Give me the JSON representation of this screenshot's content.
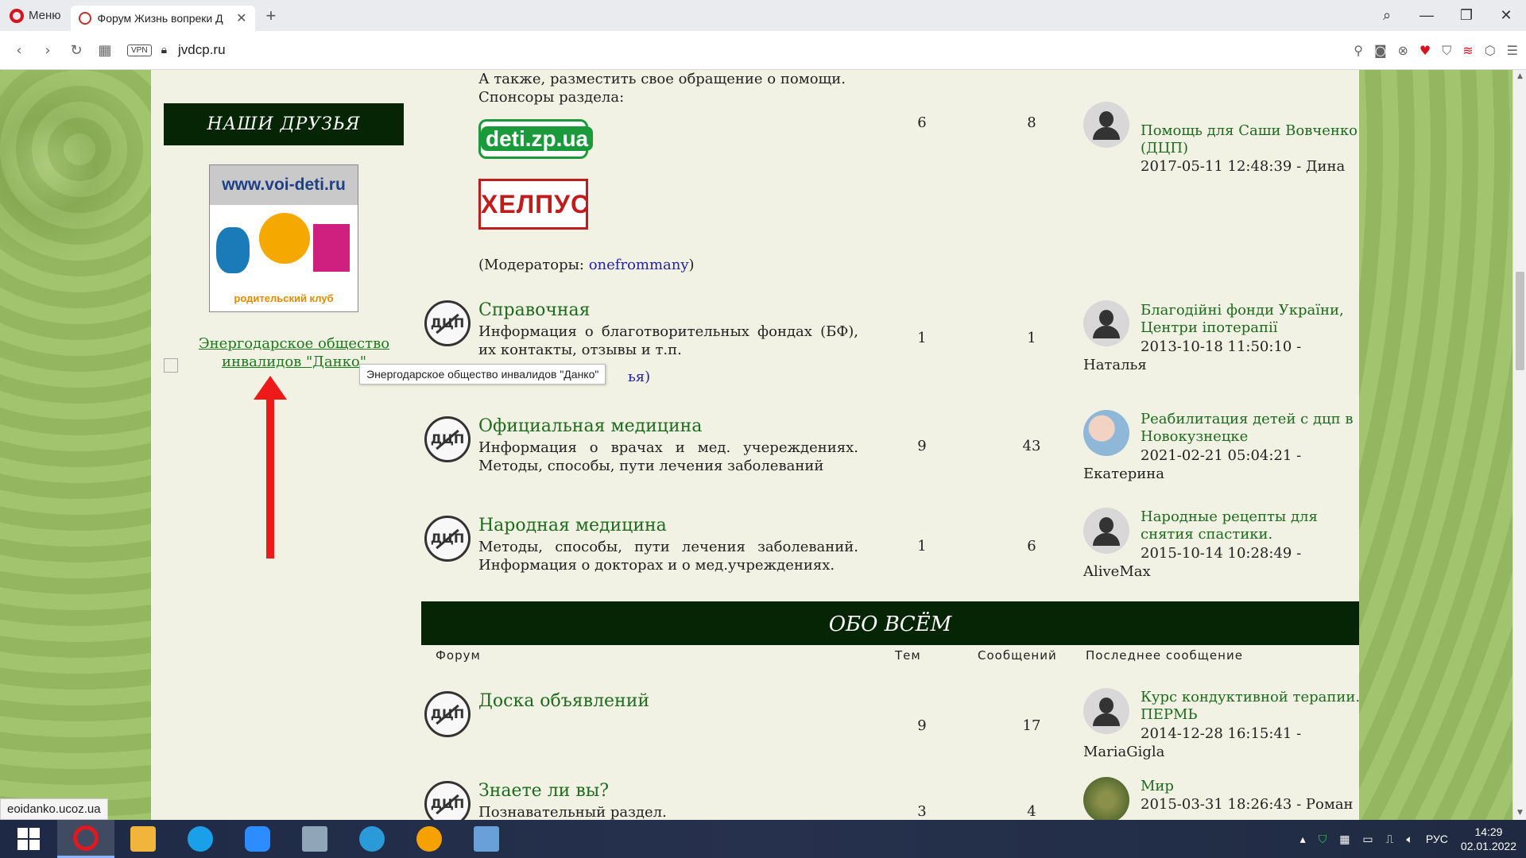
{
  "browser": {
    "menu_label": "Меню",
    "tab_title": "Форум Жизнь вопреки Д",
    "url": "jvdcp.ru",
    "vpn_label": "VPN"
  },
  "statusbar": {
    "text": "eoidanko.ucoz.ua"
  },
  "sidebar": {
    "friends_heading": "НАШИ ДРУЗЬЯ",
    "voi_site": "www.voi-deti.ru",
    "voi_sub": "родительский клуб",
    "danko_link": "Энергодарское общество инвалидов \"Данко\"",
    "tooltip": "Энергодарское общество инвалидов \"Данко\""
  },
  "top_block": {
    "desc_line1": "А также, разместить свое обращение о помощи.",
    "desc_line2": "Спонсоры раздела:",
    "sponsor1": "deti.zp.ua",
    "sponsor2": "ХЕЛПУС",
    "moderators_prefix": "(Модераторы: ",
    "moderator": "onefrommany",
    "moderators_suffix": ")",
    "topics": "6",
    "posts": "8",
    "last_title": "Помощь для Саши Вовченко (ДЦП)",
    "last_meta": "2017-05-11 12:48:39 - Дина"
  },
  "forums": [
    {
      "title": "Справочная",
      "desc": "Информация о благотворительных фондах (БФ), их контакты, отзывы и т.п.",
      "mod_partial": "ья)",
      "topics": "1",
      "posts": "1",
      "last_title": "Благодійні фонди України, Центри іпотерапії",
      "last_meta": "2013-10-18 11:50:10 - Наталья"
    },
    {
      "title": "Официальная медицина",
      "desc": "Информация о врачах и мед. учереждениях. Методы, способы, пути лечения заболеваний",
      "topics": "9",
      "posts": "43",
      "last_title": "Реабилитация детей с дцп в Новокузнецке",
      "last_meta": "2021-02-21 05:04:21 - Екатерина"
    },
    {
      "title": "Народная медицина",
      "desc": "Методы, способы, пути лечения заболеваний. Информация о докторах и о мед.учреждениях.",
      "topics": "1",
      "posts": "6",
      "last_title": "Народные рецепты для снятия спастики.",
      "last_meta": "2015-10-14 10:28:49 - AliveMax"
    }
  ],
  "section2": {
    "heading": "ОБО ВСЁМ",
    "col_forum": "Форум",
    "col_topics": "Тем",
    "col_posts": "Сообщений",
    "col_last": "Последнее сообщение"
  },
  "forums2": [
    {
      "title": "Доска объявлений",
      "topics": "9",
      "posts": "17",
      "last_title": "Курс кондуктивной терапии. ПЕРМЬ",
      "last_meta": "2014-12-28 16:15:41 - MariaGigla"
    },
    {
      "title": "Знаете ли вы?",
      "desc": "Познавательный раздел.",
      "topics": "3",
      "posts": "4",
      "last_title": "Мир",
      "last_meta": "2015-03-31 18:26:43 - Роман"
    }
  ],
  "icon_text": "ДЦП",
  "taskbar": {
    "lang": "РУС",
    "time": "14:29",
    "date": "02.01.2022"
  }
}
